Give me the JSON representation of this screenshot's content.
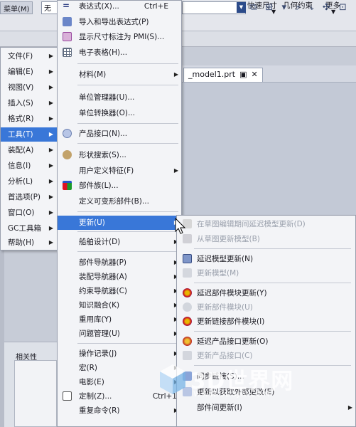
{
  "ribbon": {
    "quick_size": "快速尺寸",
    "geometric_constraint": "几何约束",
    "more": "更多"
  },
  "toolbar": {
    "menu_button": "菜单(M)",
    "filter_value": "无"
  },
  "document_tab": {
    "label": "_model1.prt"
  },
  "panel": {
    "relevance": "相关性"
  },
  "main_menu": {
    "items": [
      {
        "label": "文件(F)",
        "has_submenu": true
      },
      {
        "label": "编辑(E)",
        "has_submenu": true
      },
      {
        "label": "视图(V)",
        "has_submenu": true
      },
      {
        "label": "插入(S)",
        "has_submenu": true
      },
      {
        "label": "格式(R)",
        "has_submenu": true
      },
      {
        "label": "工具(T)",
        "has_submenu": true,
        "highlighted": true
      },
      {
        "label": "装配(A)",
        "has_submenu": true
      },
      {
        "label": "信息(I)",
        "has_submenu": true
      },
      {
        "label": "分析(L)",
        "has_submenu": true
      },
      {
        "label": "首选项(P)",
        "has_submenu": true
      },
      {
        "label": "窗口(O)",
        "has_submenu": true
      },
      {
        "label": "GC工具箱",
        "has_submenu": true
      },
      {
        "label": "帮助(H)",
        "has_submenu": true
      }
    ]
  },
  "tools_menu": {
    "items": [
      {
        "label": "表达式(X)...",
        "shortcut": "Ctrl+E",
        "icon": "equals-icon"
      },
      {
        "label": "导入和导出表达式(P)",
        "icon": "import-export-icon"
      },
      {
        "label": "显示尺寸标注为 PMI(S)...",
        "icon": "pmi-icon"
      },
      {
        "label": "电子表格(H)...",
        "icon": "spreadsheet-icon"
      },
      {
        "label": "材料(M)",
        "has_submenu": true
      },
      {
        "label": "单位管理器(U)..."
      },
      {
        "label": "单位转换器(O)..."
      },
      {
        "label": "产品接口(N)...",
        "icon": "product-interface-icon"
      },
      {
        "label": "形状搜索(S)...",
        "icon": "shape-search-icon"
      },
      {
        "label": "用户定义特征(F)",
        "has_submenu": true
      },
      {
        "label": "部件族(L)...",
        "icon": "part-family-icon"
      },
      {
        "label": "定义可变形部件(B)..."
      },
      {
        "label": "更新(U)",
        "has_submenu": true,
        "highlighted": true
      },
      {
        "label": "船舶设计(D)",
        "has_submenu": true
      },
      {
        "label": "部件导航器(P)",
        "has_submenu": true
      },
      {
        "label": "装配导航器(A)",
        "has_submenu": true
      },
      {
        "label": "约束导航器(C)",
        "has_submenu": true
      },
      {
        "label": "知识融合(K)",
        "has_submenu": true
      },
      {
        "label": "重用库(Y)",
        "has_submenu": true
      },
      {
        "label": "问题管理(U)",
        "has_submenu": true
      },
      {
        "label": "操作记录(J)",
        "has_submenu": true
      },
      {
        "label": "宏(R)",
        "has_submenu": true
      },
      {
        "label": "电影(E)",
        "has_submenu": true
      },
      {
        "label": "定制(Z)...",
        "shortcut": "Ctrl+1",
        "icon": "customize-icon"
      },
      {
        "label": "重复命令(R)",
        "has_submenu": true
      }
    ]
  },
  "update_menu": {
    "items": [
      {
        "label": "在草图编辑期间延迟模型更新(D)",
        "disabled": true,
        "icon": "delay-sketch-icon"
      },
      {
        "label": "从草图更新模型(B)",
        "disabled": true,
        "icon": "update-from-sketch-icon"
      },
      {
        "label": "延迟模型更新(N)",
        "icon": "delay-model-update-icon"
      },
      {
        "label": "更新模型(M)",
        "disabled": true,
        "icon": "update-model-icon"
      },
      {
        "label": "延迟部件模块更新(Y)",
        "icon": "delay-part-module-icon"
      },
      {
        "label": "更新部件模块(U)",
        "disabled": true,
        "icon": "update-part-module-icon"
      },
      {
        "label": "更新链接部件模块(I)",
        "icon": "update-linked-module-icon"
      },
      {
        "label": "延迟产品接口更新(O)",
        "icon": "delay-product-interface-icon"
      },
      {
        "label": "更新产品接口(C)",
        "disabled": true,
        "icon": "update-product-interface-icon"
      },
      {
        "label": "同步链接(S)...",
        "icon": "sync-link-icon"
      },
      {
        "label": "更新以获取外部更改(E)",
        "icon": "update-external-icon"
      },
      {
        "label": "部件间更新(I)",
        "has_submenu": true
      }
    ]
  },
  "watermark": {
    "title": "3D世界网",
    "url": "WWW.3DSJW.COM"
  },
  "colors": {
    "highlight": "#3977d8",
    "menu_bg": "#f3f4f7",
    "disabled_text": "#9aa0ac"
  }
}
